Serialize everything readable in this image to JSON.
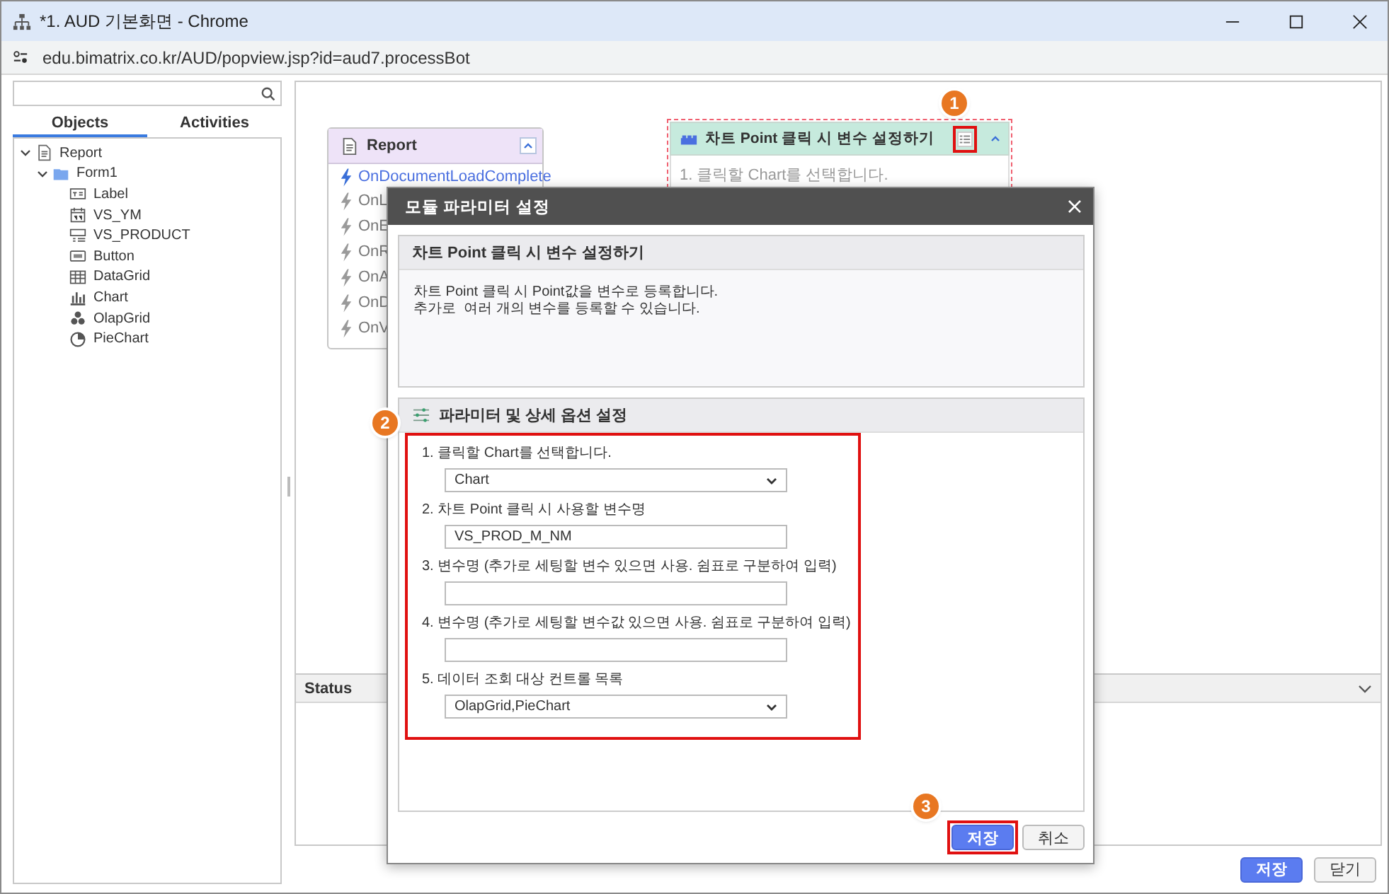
{
  "window": {
    "title": "*1. AUD 기본화면 - Chrome"
  },
  "address_bar": {
    "url": "edu.bimatrix.co.kr/AUD/popview.jsp?id=aud7.processBot"
  },
  "sidebar": {
    "tabs": [
      {
        "label": "Objects",
        "selected": true
      },
      {
        "label": "Activities",
        "selected": false
      }
    ],
    "tree": [
      {
        "label": "Report",
        "kind": "report",
        "expanded": true,
        "children": [
          {
            "label": "Form1",
            "kind": "folder",
            "expanded": true,
            "children": [
              {
                "label": "Label",
                "kind": "label"
              },
              {
                "label": "VS_YM",
                "kind": "calendar"
              },
              {
                "label": "VS_PRODUCT",
                "kind": "combo"
              },
              {
                "label": "Button",
                "kind": "button"
              },
              {
                "label": "DataGrid",
                "kind": "grid"
              },
              {
                "label": "Chart",
                "kind": "chart"
              },
              {
                "label": "OlapGrid",
                "kind": "olap"
              },
              {
                "label": "PieChart",
                "kind": "pie"
              }
            ]
          }
        ]
      }
    ]
  },
  "canvas": {
    "report_node": {
      "title": "Report",
      "events": [
        {
          "label": "OnDocumentLoadComplete",
          "active": true
        },
        {
          "label": "OnL",
          "active": false
        },
        {
          "label": "OnE",
          "active": false
        },
        {
          "label": "OnR",
          "active": false
        },
        {
          "label": "OnA",
          "active": false
        },
        {
          "label": "OnD",
          "active": false
        },
        {
          "label": "OnV",
          "active": false
        }
      ]
    },
    "module_node": {
      "title": "차트 Point 클릭 시 변수 설정하기",
      "step": "1. 클릭할 Chart를 선택합니다.",
      "selected": true
    }
  },
  "status_panel": {
    "title": "Status"
  },
  "footer_buttons": [
    {
      "label": "저장",
      "kind": "primary"
    },
    {
      "label": "닫기",
      "kind": "secondary"
    }
  ],
  "dialog": {
    "title": "모듈 파라미터 설정",
    "module": {
      "title": "차트 Point 클릭 시 변수 설정하기",
      "description": [
        "차트 Point 클릭 시 Point값을 변수로 등록합니다.",
        "추가로  여러 개의 변수를 등록할 수 있습니다."
      ]
    },
    "params": {
      "title": "파라미터 및 상세 옵션 설정",
      "fields": [
        {
          "label": "1. 클릭할 Chart를 선택합니다.",
          "kind": "select",
          "value": "Chart"
        },
        {
          "label": "2. 차트 Point 클릭 시 사용할 변수명",
          "kind": "text",
          "value": "VS_PROD_M_NM"
        },
        {
          "label": "3. 변수명 (추가로 세팅할 변수 있으면 사용. 쉼표로 구분하여 입력)",
          "kind": "text"
        },
        {
          "label": "4. 변수명 (추가로 세팅할 변수값 있으면 사용. 쉼표로 구분하여 입력)",
          "kind": "text"
        },
        {
          "label": "5. 데이터 조회 대상 컨트롤 목록",
          "kind": "select",
          "value": "OlapGrid,PieChart"
        }
      ]
    },
    "buttons": [
      {
        "label": "저장",
        "kind": "primary"
      },
      {
        "label": "취소",
        "kind": "secondary"
      }
    ]
  },
  "callouts": [
    "1",
    "2",
    "3"
  ]
}
